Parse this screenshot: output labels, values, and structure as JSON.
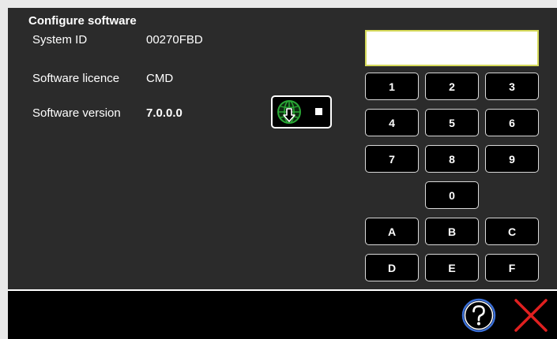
{
  "header": {
    "title": "Configure software"
  },
  "info": {
    "system_id_label": "System ID",
    "system_id_value": "00270FBD",
    "licence_label": "Software licence",
    "licence_value": "CMD",
    "version_label": "Software version",
    "version_value": "7.0.0.0"
  },
  "entry": {
    "value": "",
    "placeholder": ""
  },
  "keypad": {
    "k1": "1",
    "k2": "2",
    "k3": "3",
    "k4": "4",
    "k5": "5",
    "k6": "6",
    "k7": "7",
    "k8": "8",
    "k9": "9",
    "k0": "0",
    "kA": "A",
    "kB": "B",
    "kC": "C",
    "kD": "D",
    "kE": "E",
    "kF": "F"
  },
  "icons": {
    "download": "globe-download-icon",
    "stop": "stop-square-icon",
    "help": "help-question-icon",
    "close": "close-x-icon"
  },
  "colors": {
    "panel_background": "#2b2b2b",
    "footer_background": "#000000",
    "entry_border": "#d5d95a",
    "globe_green": "#2aa835",
    "close_red": "#e02020",
    "help_blue": "#3a6fd8"
  }
}
